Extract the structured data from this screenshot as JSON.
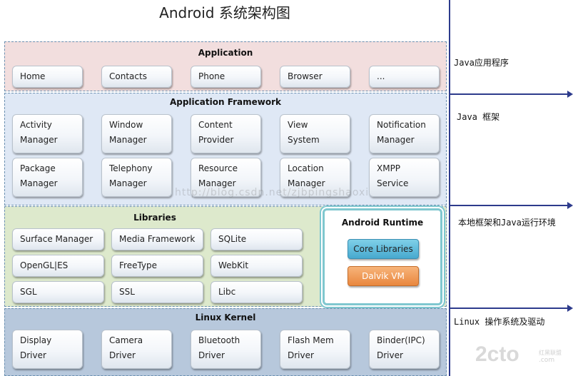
{
  "title": "Android 系统架构图",
  "layers": {
    "application": {
      "title": "Application",
      "items": [
        [
          "Home"
        ],
        [
          "Contacts"
        ],
        [
          "Phone"
        ],
        [
          "Browser"
        ],
        [
          "..."
        ]
      ]
    },
    "framework": {
      "title": "Application Framework",
      "items": [
        [
          "Activity",
          "Manager"
        ],
        [
          "Window",
          "Manager"
        ],
        [
          "Content",
          "Provider"
        ],
        [
          "View",
          "System"
        ],
        [
          "Notification",
          "Manager"
        ],
        [
          "Package",
          "Manager"
        ],
        [
          "Telephony",
          "Manager"
        ],
        [
          "Resource",
          "Manager"
        ],
        [
          "Location",
          "Manager"
        ],
        [
          "XMPP",
          "Service"
        ]
      ]
    },
    "libraries": {
      "title": "Libraries",
      "items": [
        [
          "Surface Manager"
        ],
        [
          "Media Framework"
        ],
        [
          "SQLite"
        ],
        [
          "OpenGL|ES"
        ],
        [
          "FreeType"
        ],
        [
          "WebKit"
        ],
        [
          "SGL"
        ],
        [
          "SSL"
        ],
        [
          "Libc"
        ]
      ]
    },
    "runtime": {
      "title": "Android Runtime",
      "core": "Core Libraries",
      "dalvik": "Dalvik VM"
    },
    "kernel": {
      "title": "Linux Kernel",
      "items": [
        [
          "Display",
          "Driver"
        ],
        [
          "Camera",
          "Driver"
        ],
        [
          "Bluetooth",
          "Driver"
        ],
        [
          "Flash Mem",
          "Driver"
        ],
        [
          "Binder(IPC)",
          "Driver"
        ]
      ]
    }
  },
  "side_labels": [
    "Java应用程序",
    "Java 框架",
    "本地框架和Java运行环境",
    "Linux 操作系统及驱动"
  ],
  "watermark": "http://blog.csdn.net/zjbpingshaoxi",
  "logo": {
    "main": "2cto",
    "suffix": ".com",
    "sub": "红黑联盟"
  },
  "colors": {
    "divider": "#2d3b8c",
    "runtime_border": "#7fc7cf",
    "core": "#47a9cf",
    "dalvik": "#e9873e"
  }
}
